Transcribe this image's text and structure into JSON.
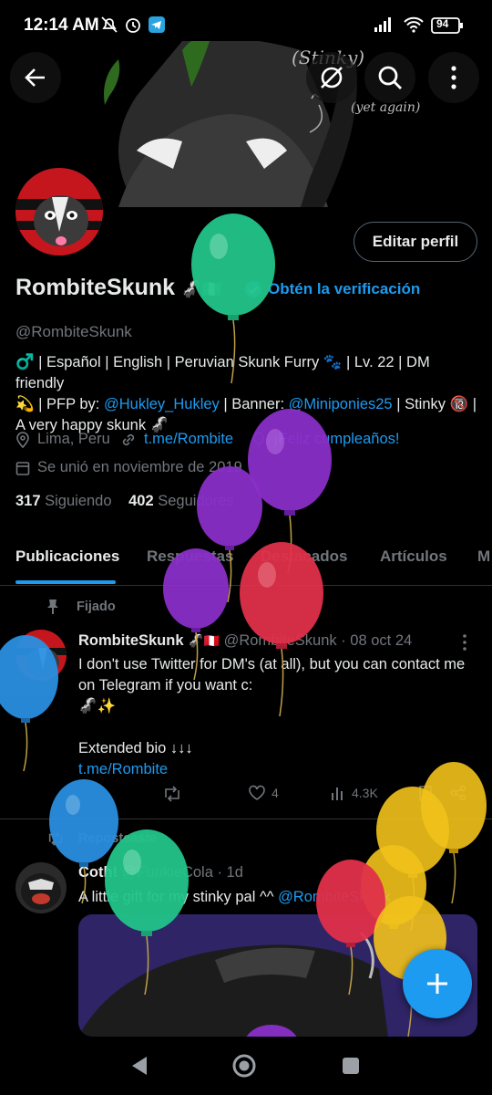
{
  "status_bar": {
    "time": "12:14 AM",
    "battery": "94"
  },
  "profile": {
    "display_name": "RombiteSkunk",
    "name_emoji": "🦨🇳🇬",
    "verify_label": "Obtén la verificación",
    "handle": "@RombiteSkunk",
    "edit_label": "Editar perfil",
    "bio_line1": "♂️ | Español | English | Peruvian Skunk Furry 🐾 | Lv. 22 | DM friendly",
    "bio_line2_a": "💫 | PFP by: ",
    "bio_line2_link1": "@Hukley_Hukley",
    "bio_line2_b": " | Banner: ",
    "bio_line2_link2": "@Miniponies25",
    "bio_line2_c": " | Stinky 🔞 |",
    "bio_line3": "A very happy skunk 🦨",
    "location": "Lima, Peru",
    "website": "t.me/Rombite",
    "birthday": "¡Feliz cumpleaños!",
    "joined": "Se unió en noviembre de 2019",
    "following_count": "317",
    "following_label": "Siguiendo",
    "followers_count": "402",
    "followers_label": "Seguidores"
  },
  "banner_text": {
    "stinky": "(Stinky)",
    "yet_again": "(yet again)"
  },
  "tabs": [
    "Publicaciones",
    "Respuestas",
    "Destacados",
    "Artículos",
    "M"
  ],
  "pinned_post": {
    "pinned_label": "Fijado",
    "author": "RombiteSkunk",
    "author_emoji": "🦨🇵🇪",
    "handle_date": "@RombiteSkunk · 08 oct 24",
    "line1": "I don't use Twitter for DM's (at all), but you can contact me",
    "line2": "on Telegram if you want c:",
    "line3": "🦨✨",
    "line4": "Extended bio ↓↓↓",
    "link": "t.me/Rombite",
    "likes": "4",
    "views": "4.3K"
  },
  "repost": {
    "repost_label": "Reposteaste",
    "author": "Coth!",
    "handle_date": "@FunkieCola · 1d",
    "text": "A little gift for my stinky pal ^^ ",
    "mention": "@RombiteSkunk"
  },
  "colors": {
    "accent": "#1d9bf0",
    "background": "#000000",
    "muted": "#71767b"
  }
}
